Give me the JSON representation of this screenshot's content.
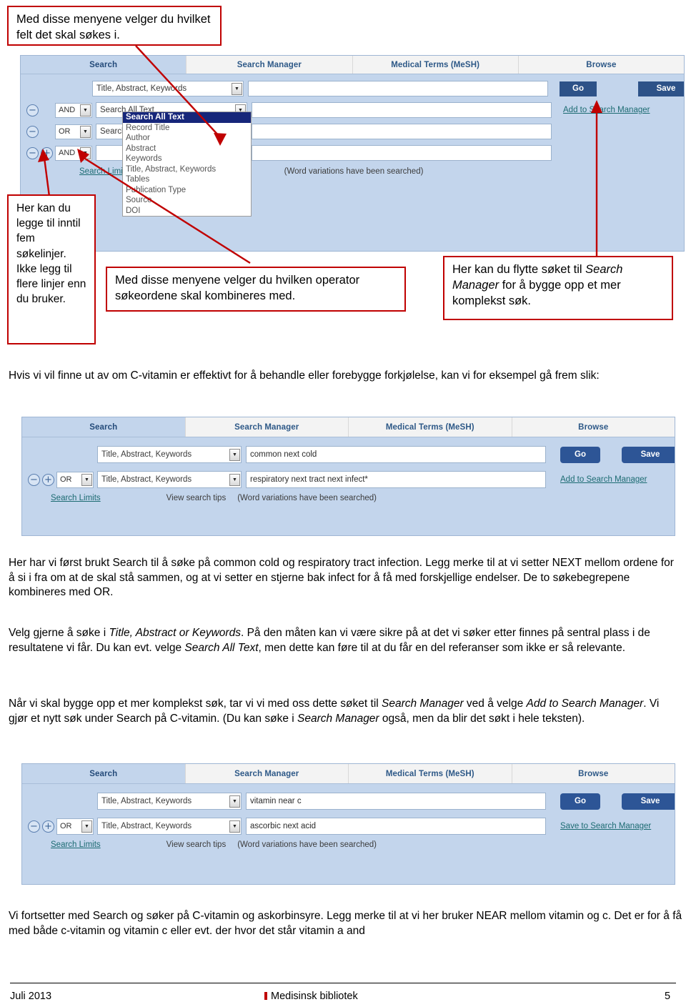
{
  "callouts": {
    "fields_menu": "Med disse menyene velger du hvilket felt det skal søkes i.",
    "max_lines": "Her kan du legge til inntil fem søkelinjer. Ikke legg til flere linjer enn du bruker.",
    "operator_menu": "Med disse menyene velger du hvilken operator søkeordene skal kombineres med.",
    "search_manager_pre": "Her kan du flytte søket til ",
    "search_manager_em": "Search Manager",
    "search_manager_post": " for å bygge opp et mer komplekst søk."
  },
  "screenshot1": {
    "tabs": [
      {
        "label": "Search",
        "active": true
      },
      {
        "label": "Search Manager",
        "active": false
      },
      {
        "label": "Medical Terms (MeSH)",
        "active": false
      },
      {
        "label": "Browse",
        "active": false
      }
    ],
    "rows": [
      {
        "operator": "",
        "field": "Title, Abstract, Keywords",
        "value": ""
      },
      {
        "operator": "AND",
        "field": "Search All Text",
        "value": ""
      },
      {
        "operator": "OR",
        "field": "Search All Text",
        "value": ""
      },
      {
        "operator": "AND",
        "field": "",
        "value": ""
      }
    ],
    "open_dropdown": {
      "options": [
        "Search All Text",
        "Record Title",
        "Author",
        "Abstract",
        "Keywords",
        "Title, Abstract, Keywords",
        "Tables",
        "Publication Type",
        "Source",
        "DOI"
      ],
      "selected": "Search All Text"
    },
    "search_limits": "Search Limits",
    "word_variations": "(Word variations have been searched)",
    "go_label": "Go",
    "save_label": "Save",
    "manager_link": "Add to Search Manager"
  },
  "screenshot2": {
    "tabs": [
      {
        "label": "Search",
        "active": true
      },
      {
        "label": "Search Manager",
        "active": false
      },
      {
        "label": "Medical Terms (MeSH)",
        "active": false
      },
      {
        "label": "Browse",
        "active": false
      }
    ],
    "rows": [
      {
        "operator": "",
        "field": "Title, Abstract, Keywords",
        "value": "common next cold"
      },
      {
        "operator": "OR",
        "field": "Title, Abstract, Keywords",
        "value": "respiratory next tract next infect*"
      }
    ],
    "search_limits": "Search Limits",
    "view_tips": "View search tips",
    "word_variations": "(Word variations have been searched)",
    "go_label": "Go",
    "save_label": "Save",
    "manager_link": "Add to Search Manager"
  },
  "screenshot3": {
    "tabs": [
      {
        "label": "Search",
        "active": true
      },
      {
        "label": "Search Manager",
        "active": false
      },
      {
        "label": "Medical Terms (MeSH)",
        "active": false
      },
      {
        "label": "Browse",
        "active": false
      }
    ],
    "rows": [
      {
        "operator": "",
        "field": "Title, Abstract, Keywords",
        "value": "vitamin near c"
      },
      {
        "operator": "OR",
        "field": "Title, Abstract, Keywords",
        "value": "ascorbic next acid"
      }
    ],
    "search_limits": "Search Limits",
    "view_tips": "View search tips",
    "word_variations": "(Word variations have been searched)",
    "go_label": "Go",
    "save_label": "Save",
    "manager_link": "Save to Search Manager"
  },
  "paragraphs": {
    "p1": "Hvis vi vil finne ut av om C-vitamin er effektivt for å behandle eller forebygge forkjølelse, kan vi for eksempel gå frem slik:",
    "p2": "Her har vi først brukt Search til å søke på common cold og respiratory tract infection. Legg merke til at vi setter NEXT mellom ordene for å si i fra om at de skal stå sammen, og at vi setter en stjerne bak infect for å få med forskjellige endelser. De to søkebegrepene kombineres med OR.",
    "p3_a": "Velg gjerne å søke i ",
    "p3_em1": "Title, Abstract or Keywords",
    "p3_b": ". På den måten kan vi være sikre på at det vi søker etter finnes på sentral plass i de resultatene vi får. Du kan evt. velge ",
    "p3_em2": "Search All Text",
    "p3_c": ", men dette kan føre til at du får en del referanser som ikke er så relevante.",
    "p4_a": "Når vi skal bygge opp et mer komplekst søk, tar vi vi med oss dette søket til ",
    "p4_em1": "Search Manager",
    "p4_b": " ved å velge ",
    "p4_em2": "Add to Search Manager",
    "p4_c": ". Vi gjør et nytt søk under Search på C-vitamin. (Du kan søke i ",
    "p4_em3": "Search Manager",
    "p4_d": " også, men da blir det søkt i hele teksten).",
    "p5": "Vi fortsetter med Search og søker på C-vitamin og askorbinsyre. Legg merke til at vi her bruker NEAR mellom vitamin og c. Det er for å få med både c-vitamin og vitamin c eller evt. der hvor det står vitamin a and"
  },
  "footer": {
    "date": "Juli 2013",
    "organisation": "Medisinsk bibliotek",
    "page_number": "5"
  },
  "colors": {
    "callout_border": "#c00000",
    "panel_bg": "#c3d5ec",
    "tab_text": "#2d5887",
    "button_bg": "#2d5288",
    "link": "#1c6b72",
    "dropdown_selected": "#16267a",
    "footer_mark": "#c00000"
  }
}
